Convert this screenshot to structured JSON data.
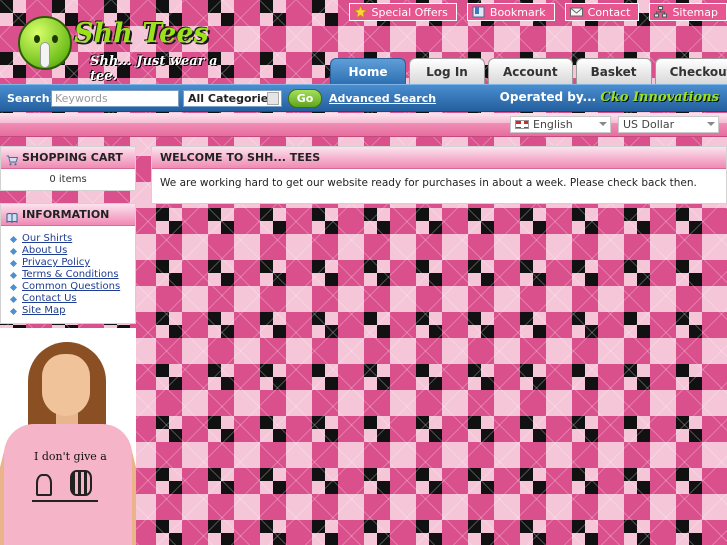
{
  "header": {
    "logo": {
      "title": "Shh Tees",
      "tagline": "Shh... Just wear a tee."
    },
    "toplinks": [
      {
        "label": "Special Offers",
        "icon": "star-icon"
      },
      {
        "label": "Bookmark",
        "icon": "bookmark-icon"
      },
      {
        "label": "Contact",
        "icon": "envelope-icon"
      },
      {
        "label": "Sitemap",
        "icon": "sitemap-icon"
      }
    ],
    "tabs": [
      {
        "label": "Home",
        "active": true
      },
      {
        "label": "Log In",
        "active": false
      },
      {
        "label": "Account",
        "active": false
      },
      {
        "label": "Basket",
        "active": false
      },
      {
        "label": "Checkout",
        "active": false
      }
    ]
  },
  "search": {
    "label": "Search:",
    "placeholder": "Keywords",
    "category": "All Categories",
    "go_label": "Go",
    "advanced_label": "Advanced Search",
    "operated_prefix": "Operated by...",
    "operated_brand": "Cko Innovations"
  },
  "selectors": {
    "language": "English",
    "currency": "US Dollar"
  },
  "sidebar": {
    "cart": {
      "title": "SHOPPING CART",
      "count_text": "0 items"
    },
    "information": {
      "title": "INFORMATION",
      "links": [
        "Our Shirts",
        "About Us",
        "Privacy Policy",
        "Terms & Conditions",
        "Common Questions",
        "Contact Us",
        "Site Map"
      ]
    },
    "model_shirt_text": "I don't give a"
  },
  "main": {
    "title": "WELCOME TO SHH... TEES",
    "message": "We are working hard to get our website ready for purchases in about a week. Please check back then."
  },
  "colors": {
    "nav_blue": "#2e6fb2",
    "brand_green": "#9be21a",
    "pink": "#e8568f"
  }
}
